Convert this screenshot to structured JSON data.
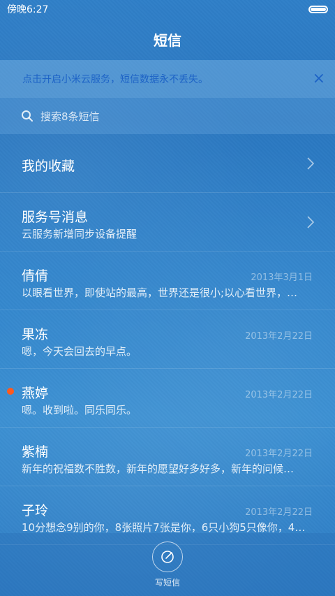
{
  "status_bar": {
    "time": "傍晚6:27"
  },
  "header": {
    "title": "短信"
  },
  "banner": {
    "text": "点击开启小米云服务，短信数据永不丢失。",
    "close_icon": "×"
  },
  "search": {
    "placeholder": "搜索8条短信"
  },
  "items": [
    {
      "name": "我的收藏",
      "preview": "",
      "date": "",
      "unread": false
    },
    {
      "name": "服务号消息",
      "preview": "云服务新增同步设备提醒",
      "date": "",
      "unread": false
    },
    {
      "name": "倩倩",
      "preview": "以眼看世界，即使站的最高，世界还是很小;以心看世界，…",
      "date": "2013年3月1日",
      "unread": false
    },
    {
      "name": "果冻",
      "preview": "嗯，今天会回去的早点。",
      "date": "2013年2月22日",
      "unread": false
    },
    {
      "name": "燕婷",
      "preview": "嗯。收到啦。同乐同乐。",
      "date": "2013年2月22日",
      "unread": true
    },
    {
      "name": "紫楠",
      "preview": "新年的祝福数不胜数，新年的愿望好多好多，新年的问候…",
      "date": "2013年2月22日",
      "unread": false
    },
    {
      "name": "子玲",
      "preview": "10分想念9别的你，8张照片7张是你，6只小狗5只像你，4…",
      "date": "2013年2月22日",
      "unread": false
    }
  ],
  "footer": {
    "compose_label": "写短信"
  },
  "colors": {
    "accent": "#1d63c6",
    "unread_dot": "#ff5a1e"
  }
}
